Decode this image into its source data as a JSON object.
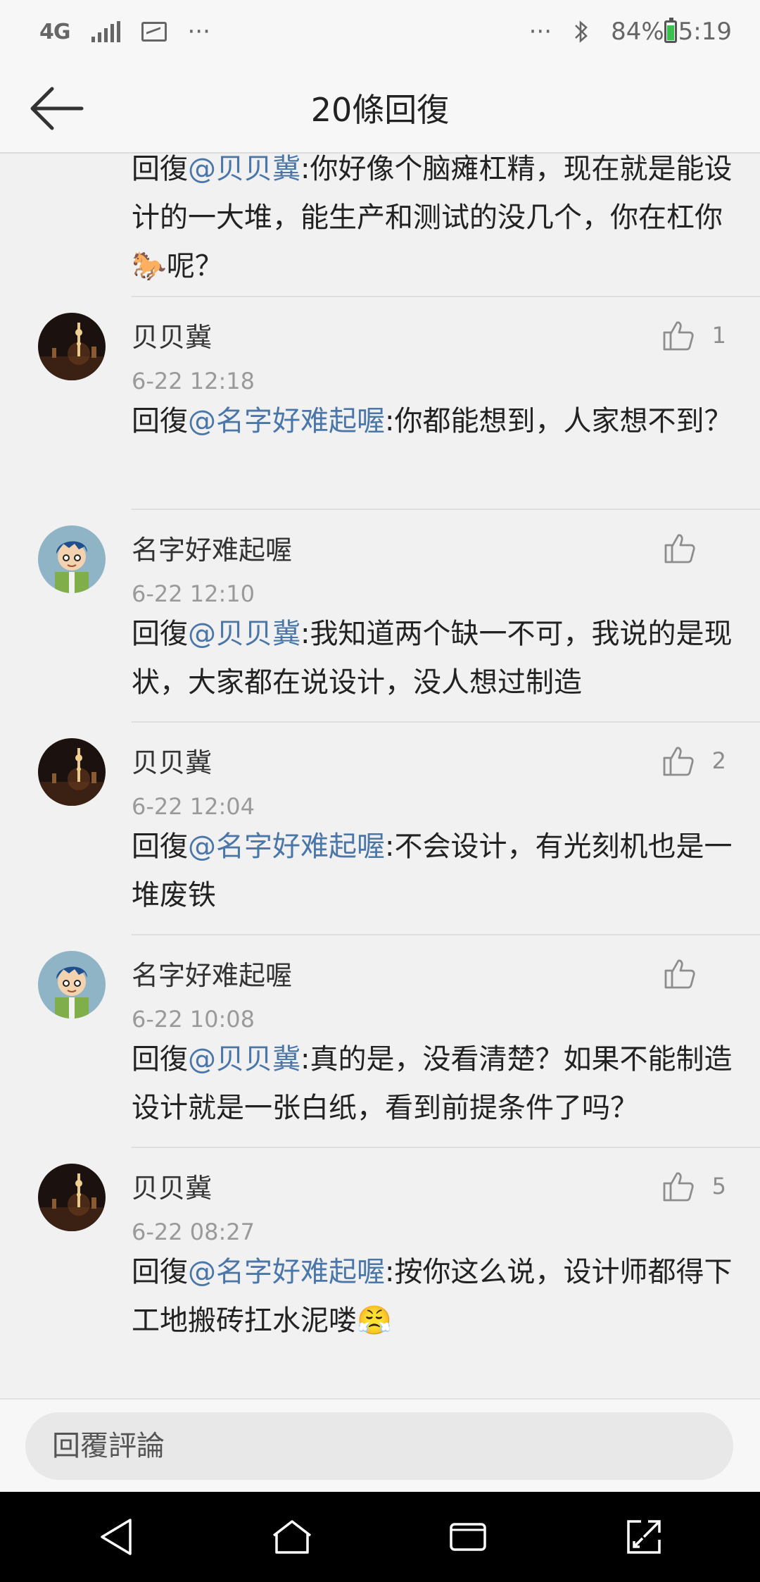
{
  "status_bar": {
    "network": "4G",
    "more_left": "···",
    "more_right": "···",
    "battery": "84%",
    "time": "5:19"
  },
  "header": {
    "title": "20條回復"
  },
  "partial_comment": {
    "prefix": "回復",
    "mention": "@贝贝冀",
    "text_1": ":你好像个脑瘫杠精，现在就是能设计的一大堆，能生产和测试的没几个，你在杠你",
    "emoji": "🐎",
    "text_2": "呢？"
  },
  "comments": [
    {
      "name": "贝贝冀",
      "time": "6-22 12:18",
      "likes": "1",
      "reply_prefix": "回復",
      "mention": "@名字好难起喔",
      "text": ":你都能想到，人家想不到？",
      "avatar": "city-night"
    },
    {
      "name": "名字好难起喔",
      "time": "6-22 12:10",
      "likes": "",
      "reply_prefix": "回復",
      "mention": "@贝贝冀",
      "text": ":我知道两个缺一不可，我说的是现状，大家都在说设计，没人想过制造",
      "avatar": "cartoon-boy"
    },
    {
      "name": "贝贝冀",
      "time": "6-22 12:04",
      "likes": "2",
      "reply_prefix": "回復",
      "mention": "@名字好难起喔",
      "text": ":不会设计，有光刻机也是一堆废铁",
      "avatar": "city-night"
    },
    {
      "name": "名字好难起喔",
      "time": "6-22 10:08",
      "likes": "",
      "reply_prefix": "回復",
      "mention": "@贝贝冀",
      "text": ":真的是，没看清楚？如果不能制造设计就是一张白纸，看到前提条件了吗？",
      "avatar": "cartoon-boy"
    },
    {
      "name": "贝贝冀",
      "time": "6-22 08:27",
      "likes": "5",
      "reply_prefix": "回復",
      "mention": "@名字好难起喔",
      "text": ":按你这么说，设计师都得下工地搬砖扛水泥喽",
      "emoji": "😤",
      "avatar": "city-night"
    }
  ],
  "reply_box": {
    "placeholder": "回覆評論"
  },
  "colors": {
    "mention": "#4a76a8",
    "background": "#f1f1f1",
    "navbar": "#000000"
  },
  "icons": {
    "back": "arrow-left-icon",
    "like": "thumbs-up-icon",
    "nav": [
      "back-triangle-icon",
      "home-icon",
      "recents-icon",
      "expand-icon"
    ]
  }
}
